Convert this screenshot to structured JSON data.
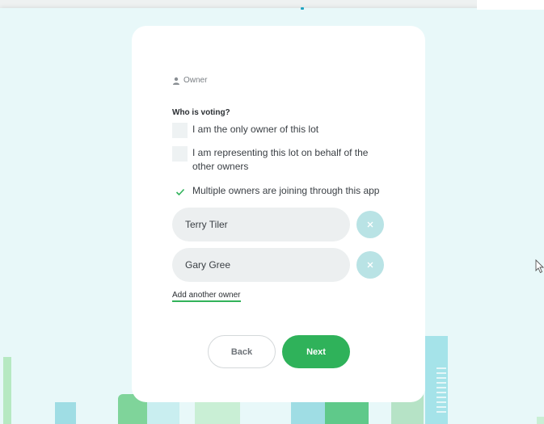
{
  "theme": {
    "accent": "#2fb25a",
    "remove_bg": "#b9e3e5",
    "background": "#e8f8f9"
  },
  "form": {
    "role_icon": "person-icon",
    "role_label": "Owner",
    "question": "Who is voting?",
    "options": [
      {
        "label": "I am the only owner of this lot",
        "checked": false
      },
      {
        "label_line1": "I am representing this lot on behalf of the",
        "label_line2": "other owners",
        "checked": false
      },
      {
        "label": "Multiple owners are joining through this app",
        "checked": true
      }
    ],
    "owners": [
      {
        "name": "Terry Tiler",
        "remove_icon": "close-icon"
      },
      {
        "name": "Gary Gree",
        "remove_icon": "close-icon"
      }
    ],
    "add_owner_label": "Add another owner",
    "back_label": "Back",
    "next_label": "Next"
  }
}
